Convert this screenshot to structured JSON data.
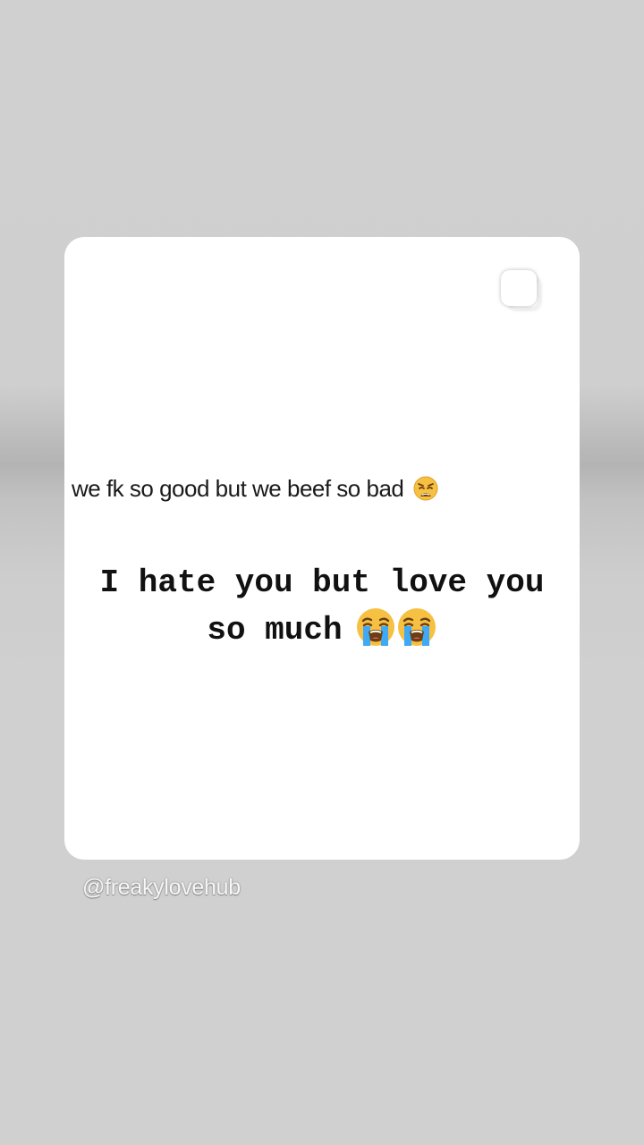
{
  "post": {
    "tweet_text": "we fk so good but we beef so bad",
    "tweet_emoji": "weary-face-emoji",
    "caption_line1": "I hate you but love you",
    "caption_line2": "so much",
    "caption_emojis": [
      "loudly-crying-face-emoji",
      "loudly-crying-face-emoji"
    ]
  },
  "watermark": {
    "handle": "@freakylovehub"
  },
  "icons": {
    "carousel": "multiple-images-icon"
  },
  "colors": {
    "background": "#d0d0d0",
    "card": "#ffffff",
    "text": "#111111"
  }
}
